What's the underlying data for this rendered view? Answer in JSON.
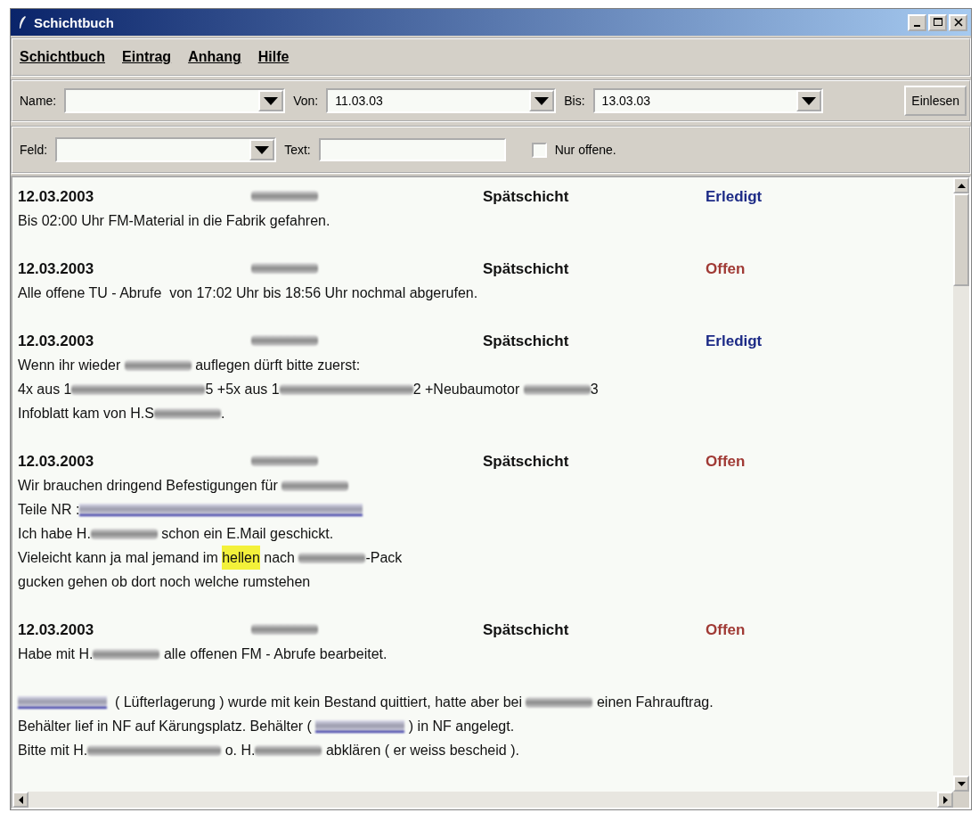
{
  "window": {
    "title": "Schichtbuch"
  },
  "menu": [
    "Schichtbuch",
    "Eintrag",
    "Anhang",
    "Hilfe"
  ],
  "filter_row_1": {
    "name_label": "Name:",
    "from_label": "Von:",
    "from_value": "11.03.03",
    "to_label": "Bis:",
    "to_value": "13.03.03",
    "load_button": "Einlesen"
  },
  "filter_row_2": {
    "field_label": "Feld:",
    "text_label": "Text:",
    "open_only": {
      "label": "Nur offene.",
      "checked": false
    }
  },
  "entries": [
    {
      "date": "12.03.2003",
      "author": {
        "kind": "blur"
      },
      "shift": "Spätschicht",
      "status": {
        "text": "Erledigt",
        "kind": "done"
      },
      "paragraphs": [
        {
          "lines": [
            [
              {
                "kind": "text",
                "text": "Bis 02:00 Uhr FM-Material in die Fabrik gefahren."
              }
            ]
          ]
        }
      ]
    },
    {
      "date": "12.03.2003",
      "author": {
        "kind": "blur"
      },
      "shift": "Spätschicht",
      "status": {
        "text": "Offen",
        "kind": "open"
      },
      "paragraphs": [
        {
          "lines": [
            [
              {
                "kind": "text",
                "text": "Alle offene TU - Abrufe  von 17:02 Uhr bis 18:56 Uhr nochmal abgerufen."
              }
            ]
          ]
        }
      ]
    },
    {
      "date": "12.03.2003",
      "author": {
        "kind": "blur"
      },
      "shift": "Spätschicht",
      "status": {
        "text": "Erledigt",
        "kind": "done"
      },
      "paragraphs": [
        {
          "lines": [
            [
              {
                "kind": "text",
                "text": "Wenn ihr wieder "
              },
              {
                "kind": "blur"
              },
              {
                "kind": "text",
                "text": " auflegen dürft bitte zuerst:"
              }
            ],
            [
              {
                "kind": "text",
                "text": "4x aus 1"
              },
              {
                "kind": "blur_long"
              },
              {
                "kind": "text",
                "text": "5 +5x aus 1"
              },
              {
                "kind": "blur_long"
              },
              {
                "kind": "text",
                "text": "2 +Neubaumotor "
              },
              {
                "kind": "blur"
              },
              {
                "kind": "text",
                "text": "3"
              }
            ],
            [
              {
                "kind": "text",
                "text": "Infoblatt kam von H.S"
              },
              {
                "kind": "blur"
              },
              {
                "kind": "text",
                "text": "."
              }
            ]
          ]
        }
      ]
    },
    {
      "date": "12.03.2003",
      "author": {
        "kind": "blur"
      },
      "shift": "Spätschicht",
      "status": {
        "text": "Offen",
        "kind": "open"
      },
      "paragraphs": [
        {
          "lines": [
            [
              {
                "kind": "text",
                "text": "Wir brauchen dringend Befestigungen für "
              },
              {
                "kind": "blur"
              }
            ],
            [
              {
                "kind": "text",
                "text": "Teile NR :"
              },
              {
                "kind": "link_blur_long"
              }
            ],
            [
              {
                "kind": "text",
                "text": "Ich habe H."
              },
              {
                "kind": "blur"
              },
              {
                "kind": "text",
                "text": " schon ein E.Mail geschickt."
              }
            ],
            [
              {
                "kind": "text",
                "text": "Vieleicht kann ja mal jemand im "
              },
              {
                "kind": "mark",
                "text": "hellen"
              },
              {
                "kind": "text",
                "text": " nach "
              },
              {
                "kind": "blur"
              },
              {
                "kind": "text",
                "text": "-Pack"
              }
            ],
            [
              {
                "kind": "text",
                "text": "gucken gehen ob dort noch welche rumstehen"
              }
            ]
          ]
        }
      ]
    },
    {
      "date": "12.03.2003",
      "author": {
        "kind": "blur"
      },
      "shift": "Spätschicht",
      "status": {
        "text": "Offen",
        "kind": "open"
      },
      "paragraphs": [
        {
          "lines": [
            [
              {
                "kind": "text",
                "text": "Habe mit H."
              },
              {
                "kind": "blur"
              },
              {
                "kind": "text",
                "text": " alle offenen FM - Abrufe bearbeitet."
              }
            ]
          ]
        },
        {
          "lines": [
            [
              {
                "kind": "link_blur"
              },
              {
                "kind": "text",
                "text": "  ( Lüfterlagerung ) wurde mit kein Bestand quittiert, hatte aber bei "
              },
              {
                "kind": "blur"
              },
              {
                "kind": "text",
                "text": " einen Fahrauftrag."
              }
            ],
            [
              {
                "kind": "text",
                "text": "Behälter lief in NF auf Kärungsplatz. Behälter ( "
              },
              {
                "kind": "link_blur"
              },
              {
                "kind": "text",
                "text": " ) in NF angelegt."
              }
            ],
            [
              {
                "kind": "text",
                "text": "Bitte mit H."
              },
              {
                "kind": "blur_long"
              },
              {
                "kind": "text",
                "text": " o. H."
              },
              {
                "kind": "blur"
              },
              {
                "kind": "text",
                "text": " abklären ( er weiss bescheid )."
              }
            ]
          ]
        }
      ]
    }
  ]
}
